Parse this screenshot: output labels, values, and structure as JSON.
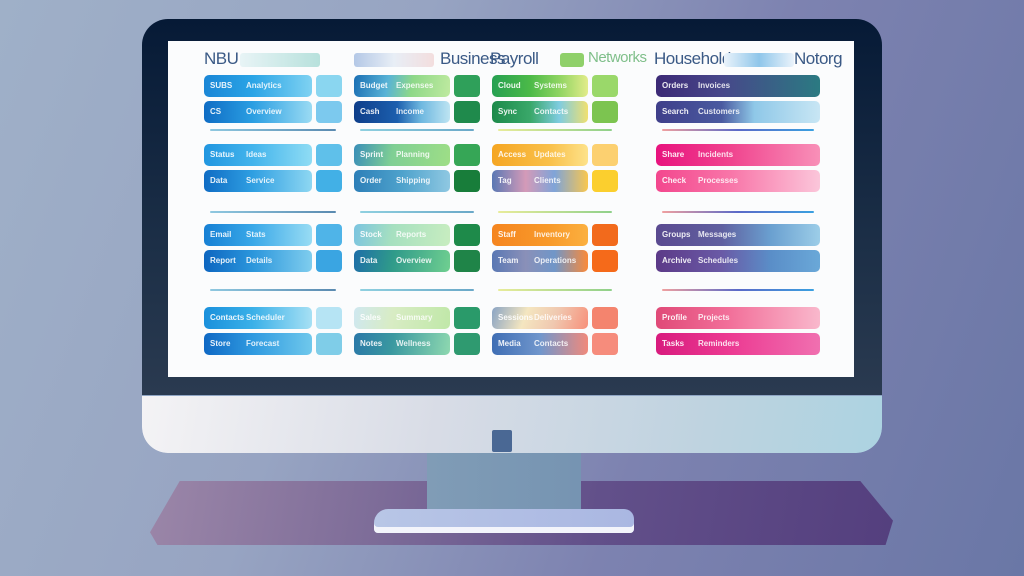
{
  "scene": {
    "description": "Illustration of a desktop monitor showing a color-coded dashboard grid",
    "colors": {
      "background_left": "#9fb0c8",
      "background_right": "#6a77a6",
      "bezel": "#0b1f3a",
      "screen": "#fbfcfd",
      "chin": "#d8dce6",
      "desk": "#62508a"
    }
  },
  "dashboard": {
    "headers": [
      "NBU",
      "Business",
      "Payroll",
      "Networks",
      "Household",
      "Notorg"
    ],
    "columns": [
      {
        "name": "blue",
        "accent": "#1e88d8",
        "cards": [
          {
            "label": "SUBS",
            "value": "Analytics"
          },
          {
            "label": "CS",
            "value": "Overview"
          },
          {
            "label": "Status",
            "value": "Ideas"
          },
          {
            "label": "Data",
            "value": "Service"
          },
          {
            "label": "Email",
            "value": "Stats"
          },
          {
            "label": "Report",
            "value": "Details"
          },
          {
            "label": "Contacts",
            "value": "Scheduler"
          },
          {
            "label": "Store",
            "value": "Forecast"
          }
        ]
      },
      {
        "name": "green",
        "accent": "#2e9e55",
        "cards": [
          {
            "label": "Budget",
            "value": "Expenses"
          },
          {
            "label": "Cash",
            "value": "Income"
          },
          {
            "label": "Sprint",
            "value": "Planning"
          },
          {
            "label": "Order",
            "value": "Shipping"
          },
          {
            "label": "Stock",
            "value": "Reports"
          },
          {
            "label": "Data",
            "value": "Overview"
          },
          {
            "label": "Sales",
            "value": "Summary"
          },
          {
            "label": "Notes",
            "value": "Wellness"
          }
        ]
      },
      {
        "name": "warm",
        "accent": "#f57c1f",
        "cards": [
          {
            "label": "Cloud",
            "value": "Systems"
          },
          {
            "label": "Sync",
            "value": "Contacts"
          },
          {
            "label": "Access",
            "value": "Updates"
          },
          {
            "label": "Tag",
            "value": "Clients"
          },
          {
            "label": "Staff",
            "value": "Inventory"
          },
          {
            "label": "Team",
            "value": "Operations"
          },
          {
            "label": "Sessions",
            "value": "Deliveries"
          },
          {
            "label": "Media",
            "value": "Contacts"
          }
        ]
      },
      {
        "name": "purple-pink",
        "accent": "#e91e84",
        "cards": [
          {
            "label": "Orders",
            "value": "Invoices"
          },
          {
            "label": "Search",
            "value": "Customers"
          },
          {
            "label": "Share",
            "value": "Incidents"
          },
          {
            "label": "Check",
            "value": "Processes"
          },
          {
            "label": "Groups",
            "value": "Messages"
          },
          {
            "label": "Archive",
            "value": "Schedules"
          },
          {
            "label": "Profile",
            "value": "Projects"
          },
          {
            "label": "Tasks",
            "value": "Reminders"
          }
        ]
      }
    ]
  }
}
